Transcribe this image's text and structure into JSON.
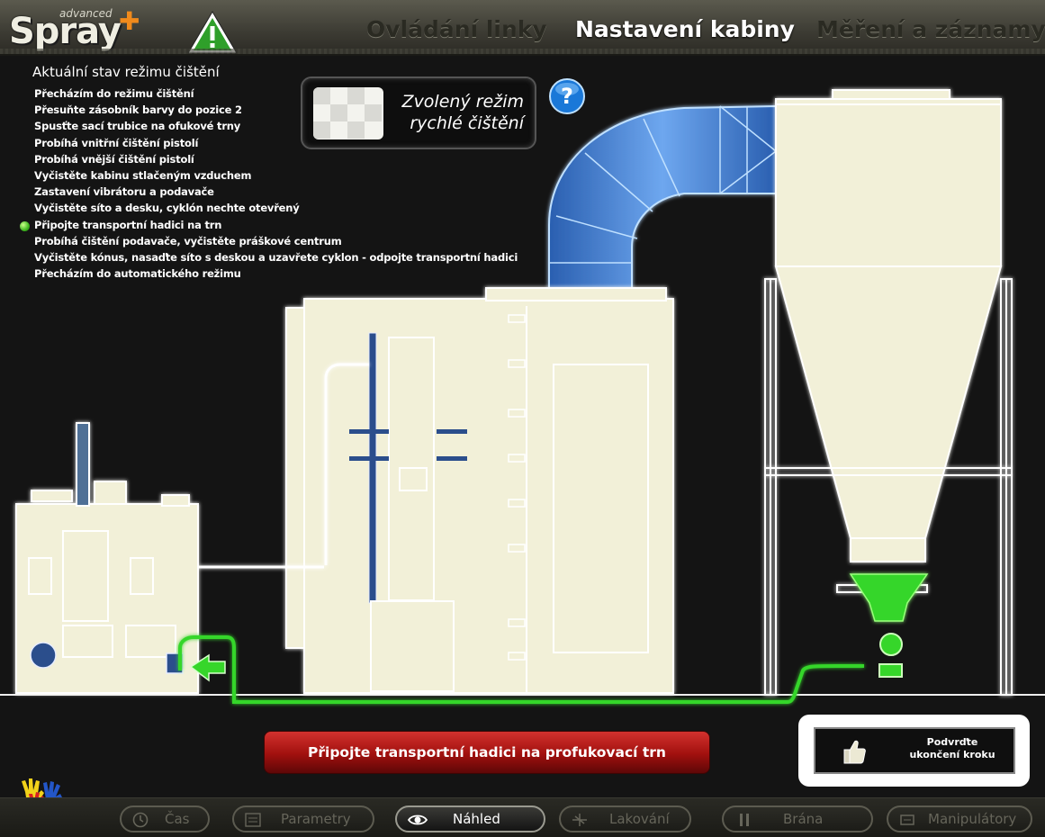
{
  "header": {
    "logo_main": "Spray",
    "logo_sub": "advanced",
    "tabs": [
      {
        "label": "Ovládání linky",
        "active": false
      },
      {
        "label": "Nastavení kabiny",
        "active": true
      },
      {
        "label": "Měření a záznamy",
        "active": false
      }
    ]
  },
  "status": {
    "title": "Aktuální stav režimu čištění",
    "steps": [
      {
        "label": "Přecházím do režimu čištění",
        "active": false
      },
      {
        "label": "Přesuňte zásobník barvy do pozice 2",
        "active": false
      },
      {
        "label": "Spusťte sací trubice na ofukové trny",
        "active": false
      },
      {
        "label": "Probíhá vnitřní čištění pistolí",
        "active": false
      },
      {
        "label": "Probíhá vnější čištění pistolí",
        "active": false
      },
      {
        "label": "Vyčistěte kabinu stlačeným vzduchem",
        "active": false
      },
      {
        "label": "Zastavení vibrátoru a podavače",
        "active": false
      },
      {
        "label": "Vyčistěte síto a desku, cyklón nechte otevřený",
        "active": false
      },
      {
        "label": "Připojte transportní hadici na trn",
        "active": true
      },
      {
        "label": "Probíhá čištění podavače, vyčistěte práškové centrum",
        "active": false
      },
      {
        "label": "Vyčistěte kónus, nasaďte síto s deskou a uzavřete cyklon - odpojte transportní hadici",
        "active": false
      },
      {
        "label": "Přecházím do automatického režimu",
        "active": false
      }
    ]
  },
  "mode": {
    "line1": "Zvolený režim",
    "line2": "rychlé čištění"
  },
  "instruction": "Připojte transportní hadici na profukovací trn",
  "confirm": {
    "line1": "Podvrďte",
    "line2": "ukončení kroku"
  },
  "bottom_nav": [
    {
      "label": "Čas",
      "icon": "clock-icon",
      "active": false
    },
    {
      "label": "Parametry",
      "icon": "sliders-icon",
      "active": false
    },
    {
      "label": "Náhled",
      "icon": "eye-icon",
      "active": true
    },
    {
      "label": "Lakování",
      "icon": "spray-gun-icon",
      "active": false
    },
    {
      "label": "Brána",
      "icon": "gate-icon",
      "active": false
    },
    {
      "label": "Manipulátory",
      "icon": "manipulator-icon",
      "active": false
    }
  ],
  "colors": {
    "equipment": "#f2f0d8",
    "duct": "#3d7fd6",
    "hose_active": "#36d62a",
    "instruction_bar": "#b01815"
  }
}
